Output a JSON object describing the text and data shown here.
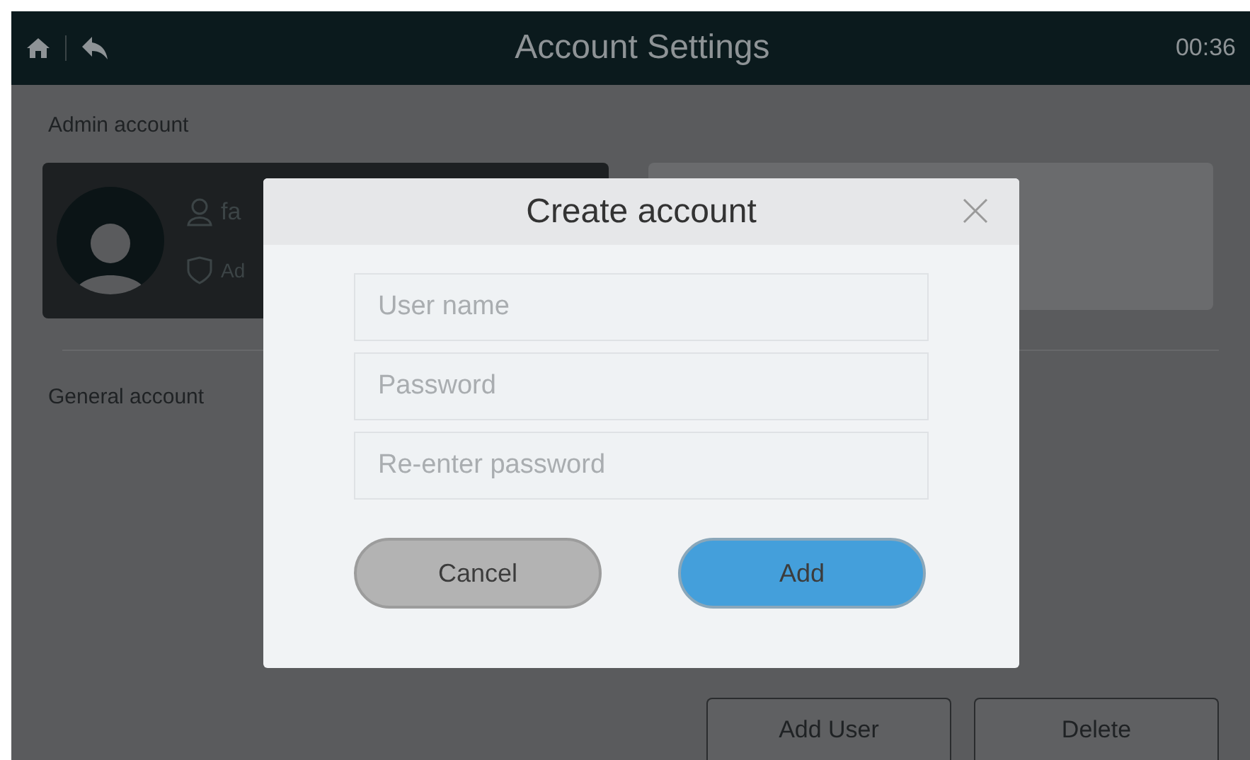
{
  "header": {
    "title": "Account Settings",
    "time": "00:36"
  },
  "admin_section": {
    "title": "Admin account",
    "card": {
      "name": "fa",
      "role": "Ad"
    }
  },
  "general_section": {
    "title": "General account"
  },
  "footer_buttons": [
    "Add User",
    "Delete"
  ],
  "dialog": {
    "title": "Create account",
    "fields": [
      {
        "placeholder": "User name"
      },
      {
        "placeholder": "Password"
      },
      {
        "placeholder": "Re-enter password"
      }
    ],
    "buttons": [
      {
        "label": "Cancel",
        "kind": "secondary"
      },
      {
        "label": "Add",
        "kind": "primary"
      }
    ]
  }
}
